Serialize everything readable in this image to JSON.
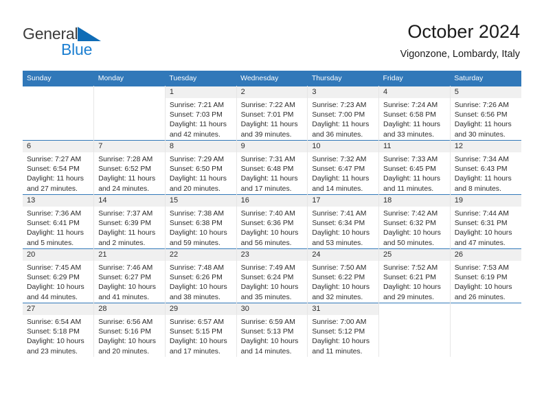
{
  "brand": {
    "name_part1": "General",
    "name_part2": "Blue",
    "triangle_color": "#0f6cb6",
    "text_color": "#3b3b3b"
  },
  "header": {
    "title": "October 2024",
    "location": "Vigonzone, Lombardy, Italy"
  },
  "theme": {
    "header_blue": "#3178b9",
    "daynum_strip": "#f0f0f0",
    "cell_border": "#e6e6e6"
  },
  "weekday_headers": [
    "Sunday",
    "Monday",
    "Tuesday",
    "Wednesday",
    "Thursday",
    "Friday",
    "Saturday"
  ],
  "weeks": [
    [
      {
        "day": "",
        "blank": true
      },
      {
        "day": "",
        "blank": true
      },
      {
        "day": "1",
        "sunrise": "Sunrise: 7:21 AM",
        "sunset": "Sunset: 7:03 PM",
        "daylight_line1": "Daylight: 11 hours",
        "daylight_line2": "and 42 minutes."
      },
      {
        "day": "2",
        "sunrise": "Sunrise: 7:22 AM",
        "sunset": "Sunset: 7:01 PM",
        "daylight_line1": "Daylight: 11 hours",
        "daylight_line2": "and 39 minutes."
      },
      {
        "day": "3",
        "sunrise": "Sunrise: 7:23 AM",
        "sunset": "Sunset: 7:00 PM",
        "daylight_line1": "Daylight: 11 hours",
        "daylight_line2": "and 36 minutes."
      },
      {
        "day": "4",
        "sunrise": "Sunrise: 7:24 AM",
        "sunset": "Sunset: 6:58 PM",
        "daylight_line1": "Daylight: 11 hours",
        "daylight_line2": "and 33 minutes."
      },
      {
        "day": "5",
        "sunrise": "Sunrise: 7:26 AM",
        "sunset": "Sunset: 6:56 PM",
        "daylight_line1": "Daylight: 11 hours",
        "daylight_line2": "and 30 minutes."
      }
    ],
    [
      {
        "day": "6",
        "sunrise": "Sunrise: 7:27 AM",
        "sunset": "Sunset: 6:54 PM",
        "daylight_line1": "Daylight: 11 hours",
        "daylight_line2": "and 27 minutes."
      },
      {
        "day": "7",
        "sunrise": "Sunrise: 7:28 AM",
        "sunset": "Sunset: 6:52 PM",
        "daylight_line1": "Daylight: 11 hours",
        "daylight_line2": "and 24 minutes."
      },
      {
        "day": "8",
        "sunrise": "Sunrise: 7:29 AM",
        "sunset": "Sunset: 6:50 PM",
        "daylight_line1": "Daylight: 11 hours",
        "daylight_line2": "and 20 minutes."
      },
      {
        "day": "9",
        "sunrise": "Sunrise: 7:31 AM",
        "sunset": "Sunset: 6:48 PM",
        "daylight_line1": "Daylight: 11 hours",
        "daylight_line2": "and 17 minutes."
      },
      {
        "day": "10",
        "sunrise": "Sunrise: 7:32 AM",
        "sunset": "Sunset: 6:47 PM",
        "daylight_line1": "Daylight: 11 hours",
        "daylight_line2": "and 14 minutes."
      },
      {
        "day": "11",
        "sunrise": "Sunrise: 7:33 AM",
        "sunset": "Sunset: 6:45 PM",
        "daylight_line1": "Daylight: 11 hours",
        "daylight_line2": "and 11 minutes."
      },
      {
        "day": "12",
        "sunrise": "Sunrise: 7:34 AM",
        "sunset": "Sunset: 6:43 PM",
        "daylight_line1": "Daylight: 11 hours",
        "daylight_line2": "and 8 minutes."
      }
    ],
    [
      {
        "day": "13",
        "sunrise": "Sunrise: 7:36 AM",
        "sunset": "Sunset: 6:41 PM",
        "daylight_line1": "Daylight: 11 hours",
        "daylight_line2": "and 5 minutes."
      },
      {
        "day": "14",
        "sunrise": "Sunrise: 7:37 AM",
        "sunset": "Sunset: 6:39 PM",
        "daylight_line1": "Daylight: 11 hours",
        "daylight_line2": "and 2 minutes."
      },
      {
        "day": "15",
        "sunrise": "Sunrise: 7:38 AM",
        "sunset": "Sunset: 6:38 PM",
        "daylight_line1": "Daylight: 10 hours",
        "daylight_line2": "and 59 minutes."
      },
      {
        "day": "16",
        "sunrise": "Sunrise: 7:40 AM",
        "sunset": "Sunset: 6:36 PM",
        "daylight_line1": "Daylight: 10 hours",
        "daylight_line2": "and 56 minutes."
      },
      {
        "day": "17",
        "sunrise": "Sunrise: 7:41 AM",
        "sunset": "Sunset: 6:34 PM",
        "daylight_line1": "Daylight: 10 hours",
        "daylight_line2": "and 53 minutes."
      },
      {
        "day": "18",
        "sunrise": "Sunrise: 7:42 AM",
        "sunset": "Sunset: 6:32 PM",
        "daylight_line1": "Daylight: 10 hours",
        "daylight_line2": "and 50 minutes."
      },
      {
        "day": "19",
        "sunrise": "Sunrise: 7:44 AM",
        "sunset": "Sunset: 6:31 PM",
        "daylight_line1": "Daylight: 10 hours",
        "daylight_line2": "and 47 minutes."
      }
    ],
    [
      {
        "day": "20",
        "sunrise": "Sunrise: 7:45 AM",
        "sunset": "Sunset: 6:29 PM",
        "daylight_line1": "Daylight: 10 hours",
        "daylight_line2": "and 44 minutes."
      },
      {
        "day": "21",
        "sunrise": "Sunrise: 7:46 AM",
        "sunset": "Sunset: 6:27 PM",
        "daylight_line1": "Daylight: 10 hours",
        "daylight_line2": "and 41 minutes."
      },
      {
        "day": "22",
        "sunrise": "Sunrise: 7:48 AM",
        "sunset": "Sunset: 6:26 PM",
        "daylight_line1": "Daylight: 10 hours",
        "daylight_line2": "and 38 minutes."
      },
      {
        "day": "23",
        "sunrise": "Sunrise: 7:49 AM",
        "sunset": "Sunset: 6:24 PM",
        "daylight_line1": "Daylight: 10 hours",
        "daylight_line2": "and 35 minutes."
      },
      {
        "day": "24",
        "sunrise": "Sunrise: 7:50 AM",
        "sunset": "Sunset: 6:22 PM",
        "daylight_line1": "Daylight: 10 hours",
        "daylight_line2": "and 32 minutes."
      },
      {
        "day": "25",
        "sunrise": "Sunrise: 7:52 AM",
        "sunset": "Sunset: 6:21 PM",
        "daylight_line1": "Daylight: 10 hours",
        "daylight_line2": "and 29 minutes."
      },
      {
        "day": "26",
        "sunrise": "Sunrise: 7:53 AM",
        "sunset": "Sunset: 6:19 PM",
        "daylight_line1": "Daylight: 10 hours",
        "daylight_line2": "and 26 minutes."
      }
    ],
    [
      {
        "day": "27",
        "sunrise": "Sunrise: 6:54 AM",
        "sunset": "Sunset: 5:18 PM",
        "daylight_line1": "Daylight: 10 hours",
        "daylight_line2": "and 23 minutes."
      },
      {
        "day": "28",
        "sunrise": "Sunrise: 6:56 AM",
        "sunset": "Sunset: 5:16 PM",
        "daylight_line1": "Daylight: 10 hours",
        "daylight_line2": "and 20 minutes."
      },
      {
        "day": "29",
        "sunrise": "Sunrise: 6:57 AM",
        "sunset": "Sunset: 5:15 PM",
        "daylight_line1": "Daylight: 10 hours",
        "daylight_line2": "and 17 minutes."
      },
      {
        "day": "30",
        "sunrise": "Sunrise: 6:59 AM",
        "sunset": "Sunset: 5:13 PM",
        "daylight_line1": "Daylight: 10 hours",
        "daylight_line2": "and 14 minutes."
      },
      {
        "day": "31",
        "sunrise": "Sunrise: 7:00 AM",
        "sunset": "Sunset: 5:12 PM",
        "daylight_line1": "Daylight: 10 hours",
        "daylight_line2": "and 11 minutes."
      },
      {
        "day": "",
        "blank": true
      },
      {
        "day": "",
        "blank": true
      }
    ]
  ]
}
